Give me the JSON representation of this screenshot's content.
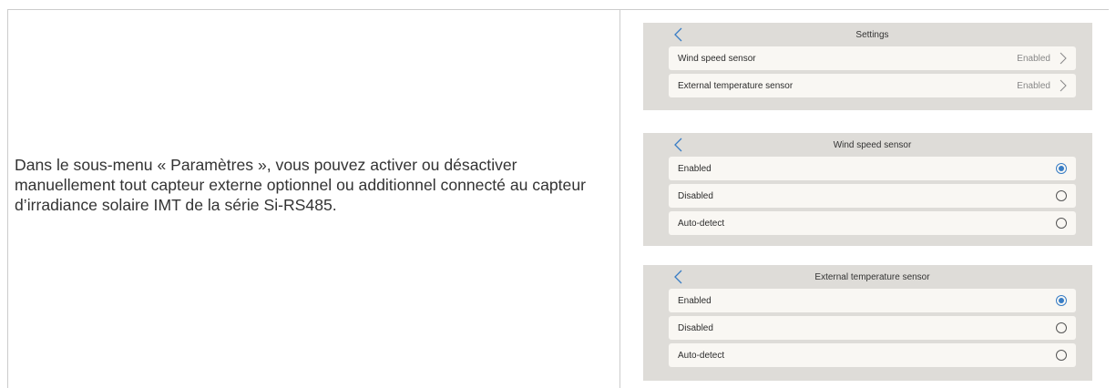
{
  "description": "Dans le sous-menu « Paramètres », vous pouvez activer ou désactiver manuellement tout capteur externe optionnel ou additionnel connecté au capteur d’irradiance solaire IMT de la série Si-RS485.",
  "settings_panel": {
    "title": "Settings",
    "items": [
      {
        "label": "Wind speed sensor",
        "value": "Enabled"
      },
      {
        "label": "External temperature sensor",
        "value": "Enabled"
      }
    ]
  },
  "wind_panel": {
    "title": "Wind speed sensor",
    "options": [
      {
        "label": "Enabled",
        "selected": true
      },
      {
        "label": "Disabled",
        "selected": false
      },
      {
        "label": "Auto-detect",
        "selected": false
      }
    ]
  },
  "temp_panel": {
    "title": "External temperature sensor",
    "options": [
      {
        "label": "Enabled",
        "selected": true
      },
      {
        "label": "Disabled",
        "selected": false
      },
      {
        "label": "Auto-detect",
        "selected": false
      }
    ]
  },
  "colors": {
    "accent": "#387dc5",
    "panel_bg": "#dedcd8",
    "row_bg": "#f9f7f3"
  }
}
